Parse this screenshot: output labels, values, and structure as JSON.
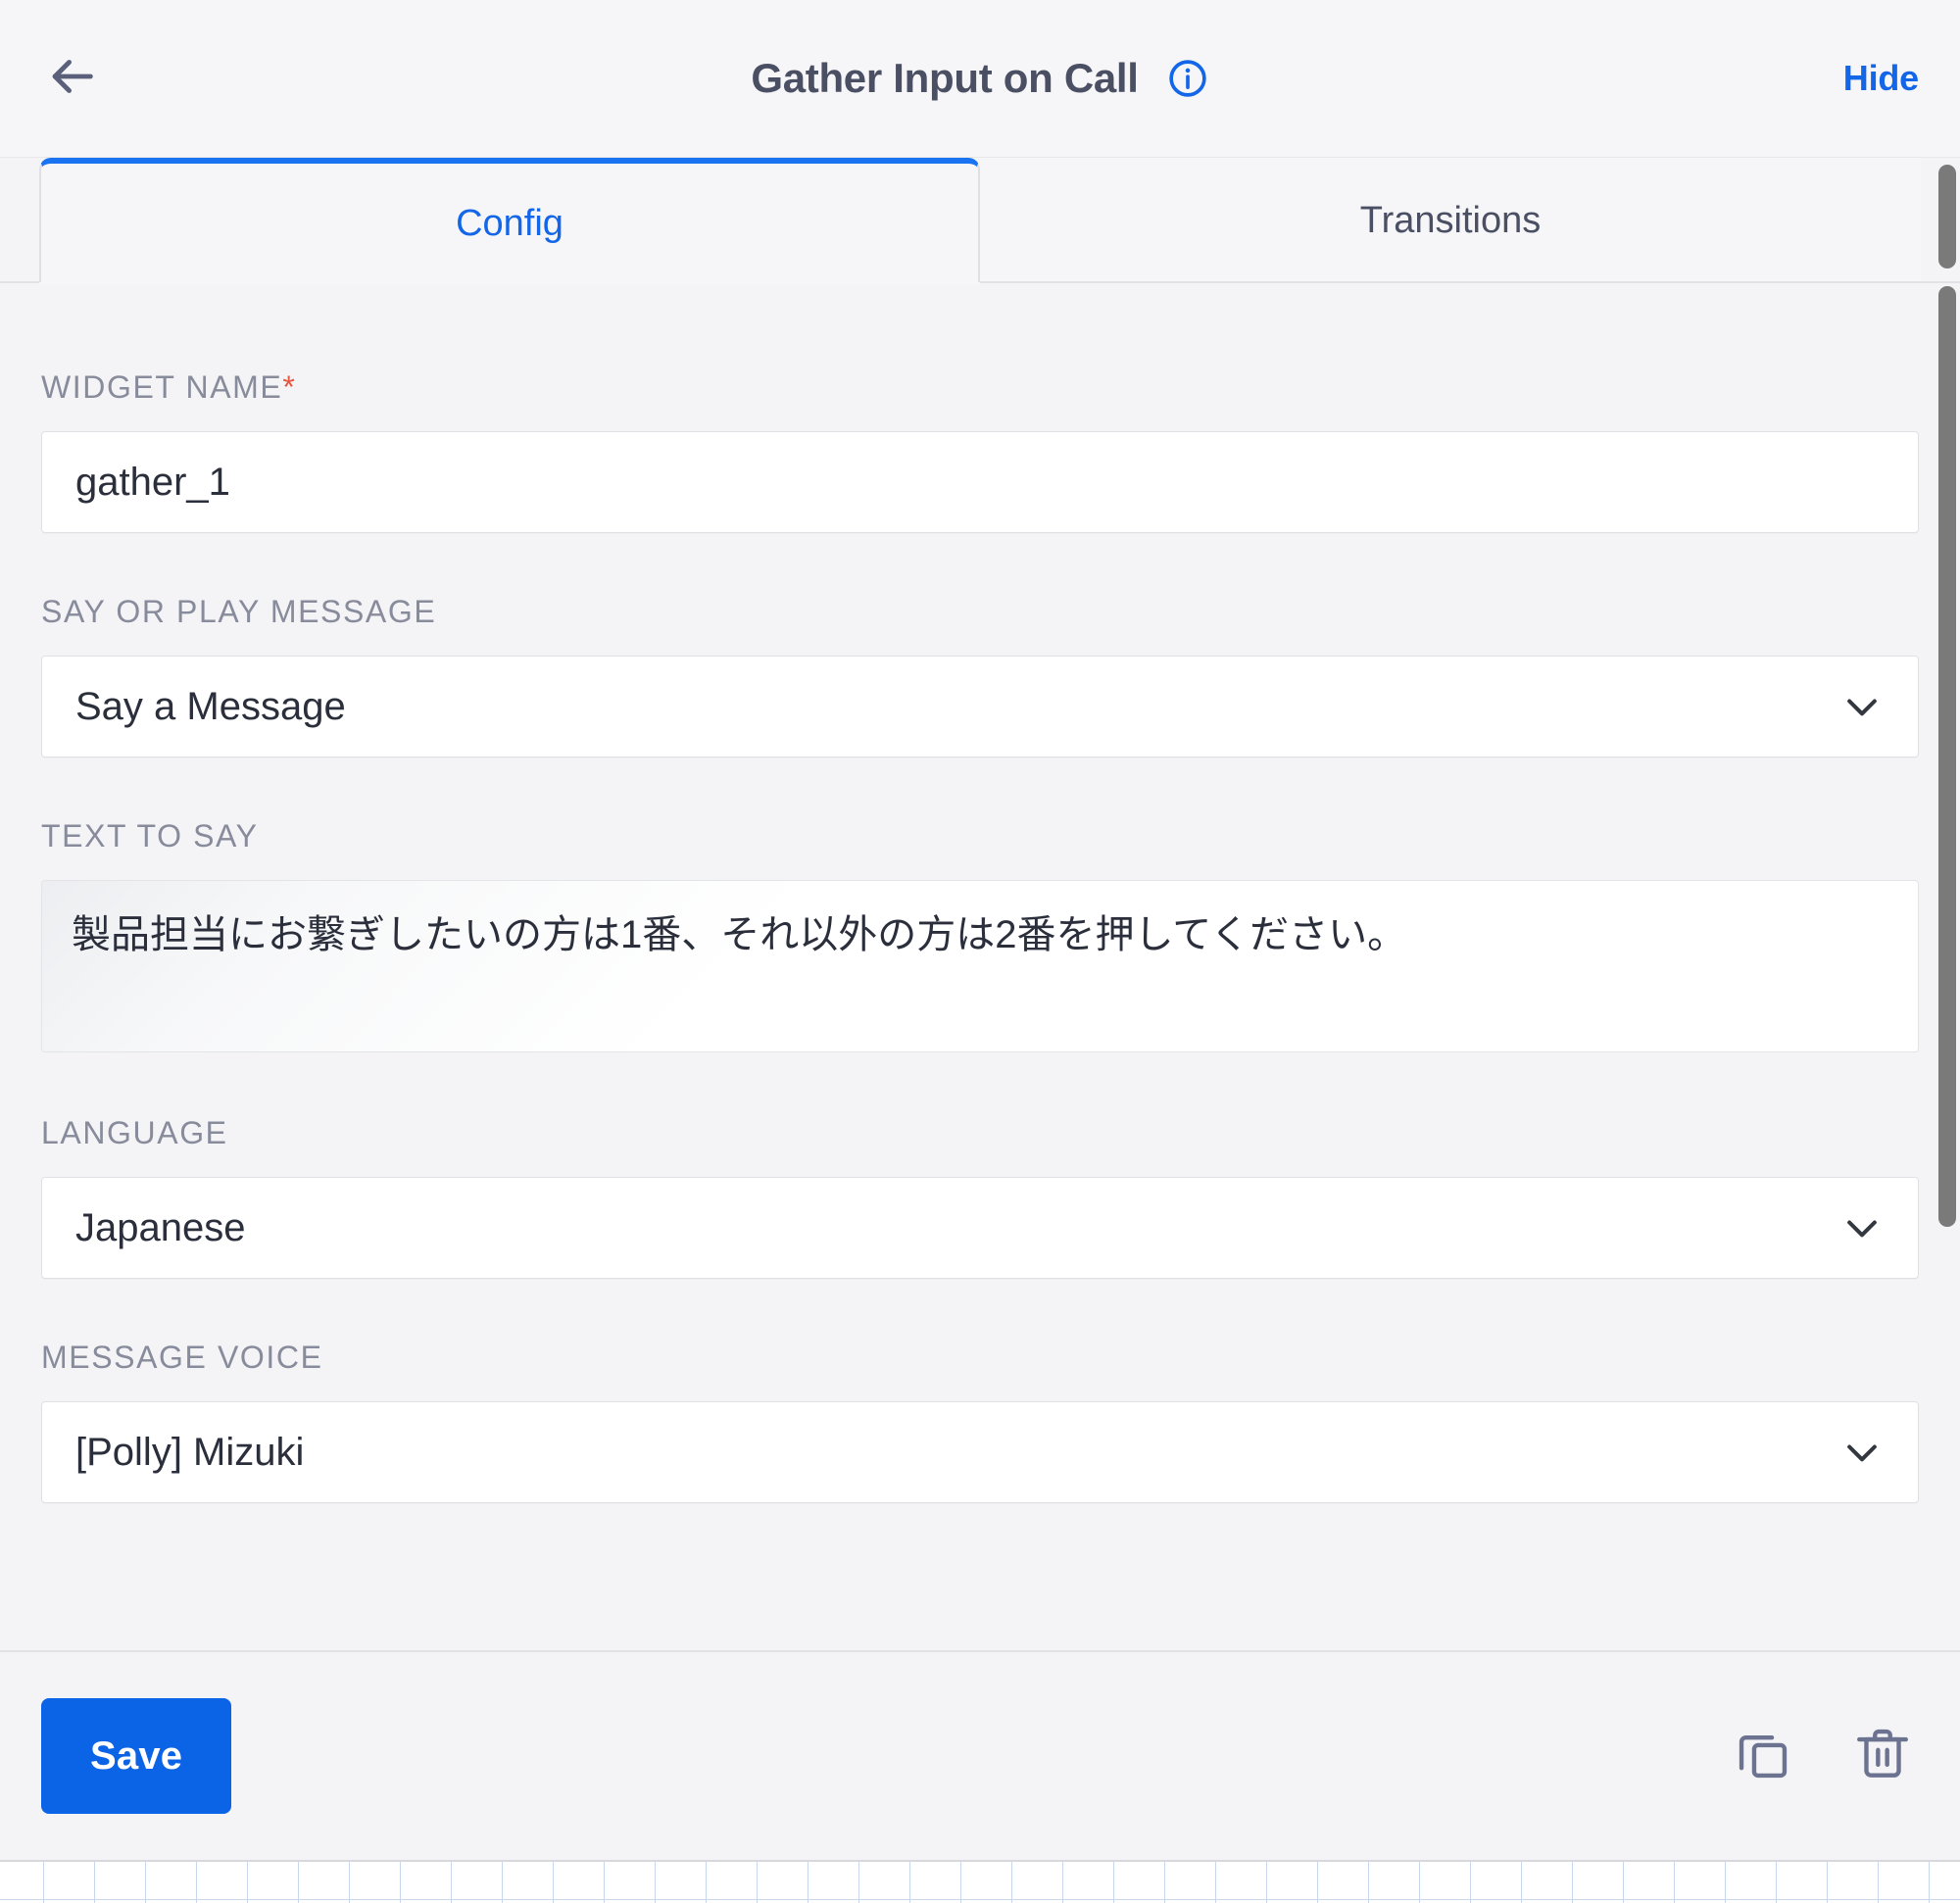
{
  "header": {
    "back_icon": "arrow-left-icon",
    "title": "Gather Input on Call",
    "info_icon": "info-circle-icon",
    "hide_label": "Hide"
  },
  "tabs": [
    {
      "label": "Config",
      "active": true
    },
    {
      "label": "Transitions",
      "active": false
    }
  ],
  "form": {
    "widget_name": {
      "label": "WIDGET NAME",
      "required_marker": "*",
      "value": "gather_1",
      "placeholder": ""
    },
    "say_or_play": {
      "label": "SAY OR PLAY MESSAGE",
      "value": "Say a Message",
      "chevron_icon": "chevron-down-icon"
    },
    "text_to_say": {
      "label": "TEXT TO SAY",
      "value": "製品担当にお繋ぎしたいの方は1番、それ以外の方は2番を押してください。",
      "placeholder": ""
    },
    "language": {
      "label": "LANGUAGE",
      "value": "Japanese",
      "chevron_icon": "chevron-down-icon"
    },
    "message_voice": {
      "label": "MESSAGE VOICE",
      "value": "[Polly] Mizuki",
      "chevron_icon": "chevron-down-icon"
    }
  },
  "footer": {
    "save_label": "Save",
    "copy_icon": "copy-icon",
    "delete_icon": "trash-icon"
  },
  "colors": {
    "accent_blue": "#1466e8",
    "save_blue": "#0b63e5",
    "tab_active_border": "#1a73f0",
    "required_red": "#e8543f",
    "label_gray": "#878b9b",
    "title_gray": "#4a4f63",
    "panel_bg": "#f4f4f6"
  }
}
